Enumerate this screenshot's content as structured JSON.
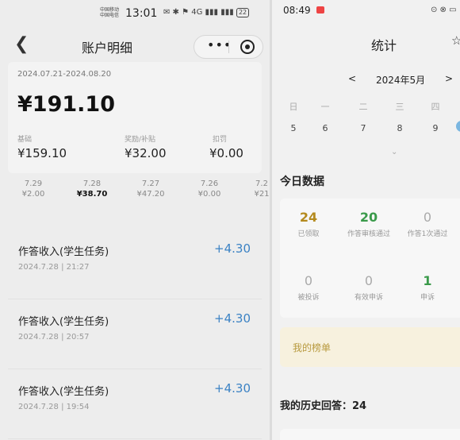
{
  "left": {
    "status": {
      "carrier_top": "中国移动",
      "carrier_bottom": "中国电信",
      "time": "13:01",
      "icons_text": "✉ ✱ ⚑ 4G ▮▮▮ ▮▮▮",
      "battery": "22"
    },
    "nav": {
      "back_icon": "chevron-left-icon",
      "title": "账户明细"
    },
    "summary": {
      "period": "2024.07.21-2024.08.20",
      "total": "¥191.10",
      "columns": [
        {
          "label": "基础",
          "value": "¥159.10"
        },
        {
          "label": "奖励/补贴",
          "value": "¥32.00"
        },
        {
          "label": "扣罚",
          "value": "¥0.00"
        }
      ]
    },
    "days": [
      {
        "date": "7.29",
        "amount": "¥2.00"
      },
      {
        "date": "7.28",
        "amount": "¥38.70"
      },
      {
        "date": "7.27",
        "amount": "¥47.20"
      },
      {
        "date": "7.26",
        "amount": "¥0.00"
      },
      {
        "date": "7.2",
        "amount": "¥21"
      }
    ],
    "selected_day_index": 1,
    "transactions": [
      {
        "title": "作答收入(学生任务)",
        "time": "2024.7.28 | 21:27",
        "amount": "+4.30"
      },
      {
        "title": "作答收入(学生任务)",
        "time": "2024.7.28 | 20:57",
        "amount": "+4.30"
      },
      {
        "title": "作答收入(学生任务)",
        "time": "2024.7.28 | 19:54",
        "amount": "+4.30"
      }
    ]
  },
  "right": {
    "status": {
      "time": "08:49",
      "icons_text": "⊙ ⊗ ▭"
    },
    "title": "统计",
    "month": "2024年5月",
    "prev": "<",
    "next": ">",
    "weekdays": [
      "日",
      "一",
      "二",
      "三",
      "四"
    ],
    "dates": [
      "5",
      "6",
      "7",
      "8",
      "9"
    ],
    "today_section": "今日数据",
    "metrics_row1": [
      {
        "value": "24",
        "label": "已领取",
        "color": "#b48a1e"
      },
      {
        "value": "20",
        "label": "作答审核通过",
        "color": "#3a9a4a"
      },
      {
        "value": "0",
        "label": "作答1次通过",
        "color": "#aaaaaa"
      }
    ],
    "metrics_row2": [
      {
        "value": "0",
        "label": "被投诉",
        "color": "#aaaaaa"
      },
      {
        "value": "0",
        "label": "有效申诉",
        "color": "#aaaaaa"
      },
      {
        "value": "1",
        "label": "申诉",
        "color": "#3a9a4a"
      }
    ],
    "rank_label": "我的榜单",
    "history": "我的历史回答：24"
  }
}
